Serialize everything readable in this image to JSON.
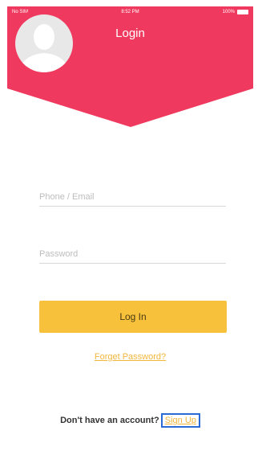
{
  "status_bar": {
    "carrier": "No SIM",
    "time": "8:52 PM",
    "battery": "100%"
  },
  "header": {
    "title": "Login"
  },
  "colors": {
    "header_bg": "#f0395e",
    "accent": "#f8c13b",
    "link": "#f2b63c",
    "focus": "#2c6bd6"
  },
  "form": {
    "phone_placeholder": "Phone / Email",
    "password_placeholder": "Password",
    "login_label": "Log In",
    "forgot_label": "Forget Password?"
  },
  "footer": {
    "no_account_text": "Don't have an account?",
    "signup_label": "Sign Up"
  }
}
